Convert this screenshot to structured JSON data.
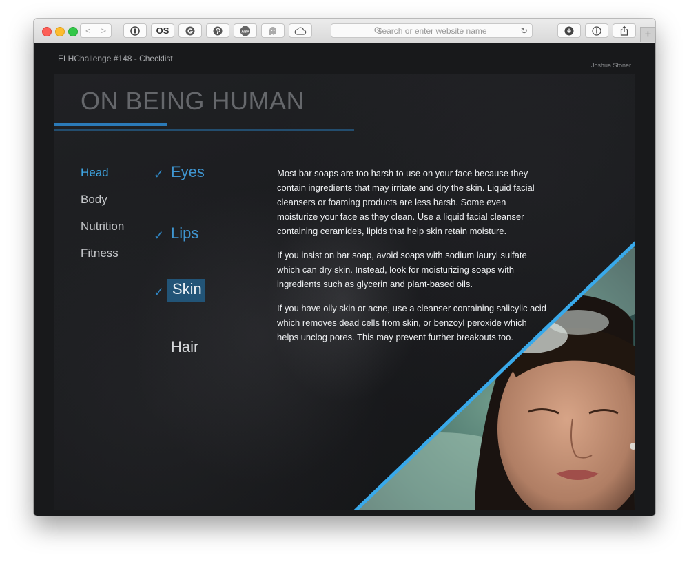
{
  "browser": {
    "address_placeholder": "Search or enter website name",
    "toolbar_icons": [
      "back-icon",
      "forward-icon",
      "onepassword-icon",
      "lastfm-icon",
      "grammarly-icon",
      "pinterest-icon",
      "adblock-icon",
      "ghostery-icon",
      "cloud-icon",
      "download-icon",
      "info-icon",
      "share-icon",
      "new-tab-icon"
    ],
    "nav_back": "<",
    "nav_forward": ">",
    "reload_glyph": "↻",
    "new_tab_glyph": "+",
    "lastfm_label": "OS",
    "abp_label": "ABP"
  },
  "page": {
    "small_title": "ELHChallenge #148 - Checklist",
    "author": "Joshua Stoner",
    "hero_title": "ON BEING HUMAN",
    "accent_color": "#3fa7e6"
  },
  "categories": [
    {
      "label": "Head",
      "active": true
    },
    {
      "label": "Body",
      "active": false
    },
    {
      "label": "Nutrition",
      "active": false
    },
    {
      "label": "Fitness",
      "active": false
    }
  ],
  "checklist": {
    "check_glyph": "✓",
    "items": [
      {
        "label": "Eyes",
        "checked": true,
        "selected": false
      },
      {
        "label": "Lips",
        "checked": true,
        "selected": false
      },
      {
        "label": "Skin",
        "checked": true,
        "selected": true
      },
      {
        "label": "Hair",
        "checked": false,
        "selected": false
      }
    ]
  },
  "content": {
    "paragraphs": [
      "Most bar soaps are too harsh to use on your face because they contain ingredients that may irritate and dry the skin. Liquid facial cleansers or foaming products are less harsh. Some even moisturize your face as they clean. Use a liquid facial cleanser containing ceramides, lipids that help skin retain moisture.",
      "If you insist on bar soap, avoid soaps with sodium lauryl sulfate which can dry skin. Instead, look for moisturizing soaps with ingredients such as glycerin and plant-based oils.",
      "If you have oily skin or acne, use a cleanser containing salicylic acid which removes dead cells from skin, or benzoyl peroxide which helps unclog pores. This may prevent further breakouts too."
    ]
  }
}
